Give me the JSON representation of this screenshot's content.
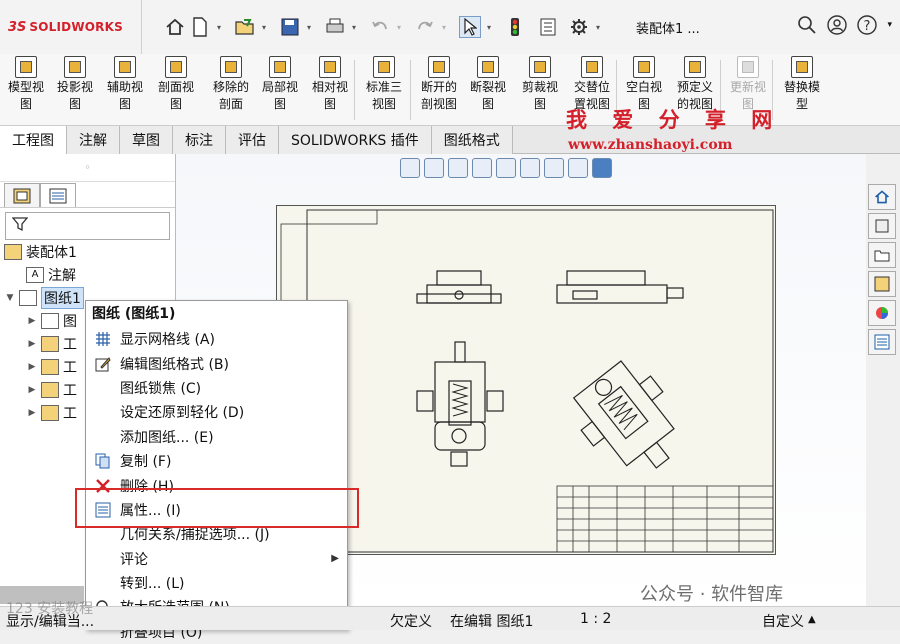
{
  "app": {
    "logo_prefix": "3S",
    "logo_text": "SOLIDWORKS",
    "document_title": "装配体1 ..."
  },
  "ribbon": {
    "items": [
      {
        "label_l1": "模型视",
        "label_l2": "图",
        "disabled": false
      },
      {
        "label_l1": "投影视",
        "label_l2": "图",
        "disabled": false
      },
      {
        "label_l1": "辅助视",
        "label_l2": "图",
        "disabled": false
      },
      {
        "label_l1": "剖面视",
        "label_l2": "图",
        "disabled": false
      },
      {
        "label_l1": "移除的",
        "label_l2": "剖面",
        "disabled": false
      },
      {
        "label_l1": "局部视",
        "label_l2": "图",
        "disabled": false
      },
      {
        "label_l1": "相对视",
        "label_l2": "图",
        "disabled": false
      },
      {
        "label_l1": "标准三",
        "label_l2": "视图",
        "disabled": false
      },
      {
        "label_l1": "断开的",
        "label_l2": "剖视图",
        "disabled": false
      },
      {
        "label_l1": "断裂视",
        "label_l2": "图",
        "disabled": false
      },
      {
        "label_l1": "剪裁视",
        "label_l2": "图",
        "disabled": false
      },
      {
        "label_l1": "交替位",
        "label_l2": "置视图",
        "disabled": false
      },
      {
        "label_l1": "空白视",
        "label_l2": "图",
        "disabled": false
      },
      {
        "label_l1": "预定义",
        "label_l2": "的视图",
        "disabled": false
      },
      {
        "label_l1": "更新视",
        "label_l2": "图",
        "disabled": true
      },
      {
        "label_l1": "替换模",
        "label_l2": "型",
        "disabled": false
      }
    ]
  },
  "tabs": [
    {
      "label": "工程图",
      "active": true
    },
    {
      "label": "注解",
      "active": false
    },
    {
      "label": "草图",
      "active": false
    },
    {
      "label": "标注",
      "active": false
    },
    {
      "label": "评估",
      "active": false
    },
    {
      "label": "SOLIDWORKS 插件",
      "active": false
    },
    {
      "label": "图纸格式",
      "active": false
    }
  ],
  "watermark": {
    "brand": "我 爱 分 享 网",
    "url": "www.zhanshaoyi.com",
    "wechat": "公众号 · 软件智库",
    "corner": "123 安装教程"
  },
  "tree": {
    "root": "装配体1",
    "annotations": "注解",
    "sheet": "图纸1",
    "children": [
      {
        "label": "图"
      },
      {
        "label": "工"
      },
      {
        "label": "工"
      },
      {
        "label": "工"
      },
      {
        "label": "工"
      }
    ]
  },
  "context_menu": {
    "header": "图纸 (图纸1)",
    "items": [
      {
        "label": "显示网格线 (A)",
        "icon": "grid-icon",
        "submenu": false
      },
      {
        "label": "编辑图纸格式 (B)",
        "icon": "edit-sheet-format-icon",
        "submenu": false
      },
      {
        "label": "图纸锁焦 (C)",
        "icon": "",
        "submenu": false
      },
      {
        "label": "设定还原到轻化 (D)",
        "icon": "",
        "submenu": false
      },
      {
        "label": "添加图纸... (E)",
        "icon": "",
        "submenu": false
      },
      {
        "label": "复制 (F)",
        "icon": "copy-icon",
        "submenu": false
      },
      {
        "label": "删除 (H)",
        "icon": "delete-icon",
        "submenu": false
      },
      {
        "label": "属性... (I)",
        "icon": "properties-icon",
        "submenu": false
      },
      {
        "label": "几何关系/捕捉选项... (J)",
        "icon": "",
        "submenu": false
      },
      {
        "label": "评论",
        "icon": "",
        "submenu": true
      },
      {
        "label": "转到... (L)",
        "icon": "",
        "submenu": false
      },
      {
        "label": "放大所选范围 (N)",
        "icon": "zoom-selection-icon",
        "submenu": false
      },
      {
        "label": "折叠项目 (O)",
        "icon": "",
        "submenu": false
      }
    ]
  },
  "statusbar": {
    "left": "显示/编辑当...",
    "underdefined": "欠定义",
    "editing": "在编辑 图纸1",
    "scale": "1 : 2",
    "custom": "自定义"
  },
  "colors": {
    "accent_red": "#d4202a",
    "selection_blue": "#cfe3f9",
    "highlight_box": "#d92a2a"
  }
}
